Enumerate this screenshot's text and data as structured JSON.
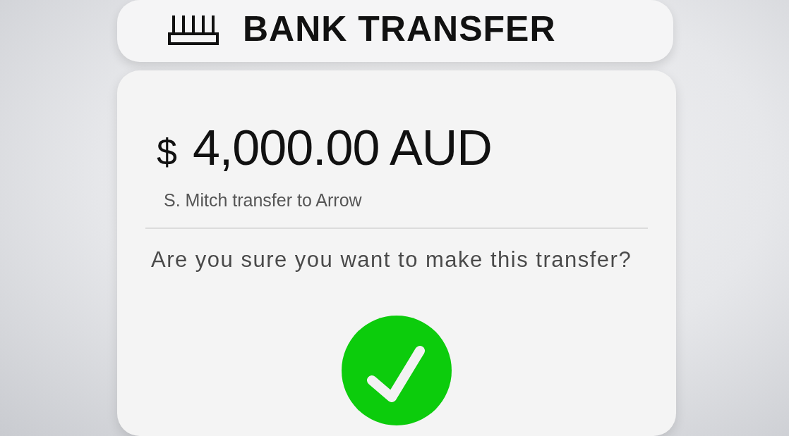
{
  "header": {
    "title": "BANK TRANSFER"
  },
  "transfer": {
    "currency_symbol": "$",
    "amount": "4,000.00",
    "currency": "AUD",
    "description": "S. Mitch transfer to Arrow"
  },
  "prompt": "Are you sure you want to make this transfer?",
  "confirm": {
    "kind": "check"
  }
}
